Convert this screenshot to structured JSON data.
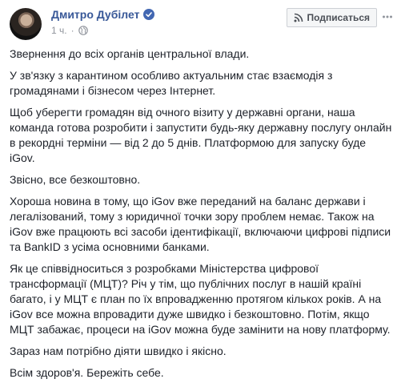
{
  "header": {
    "author_name": "Дмитро Дубілет",
    "timestamp": "1 ч.",
    "subscribe_label": "Подписаться",
    "verified_icon": "verified-badge-icon",
    "privacy_icon": "globe-icon",
    "subscribe_icon": "rss-icon",
    "more_icon": "more-options-icon"
  },
  "post": {
    "paragraphs": [
      "Звернення до всіх органів центральної влади.",
      "У зв'язку з карантином особливо актуальним стає взаємодія з громадянами і бізнесом через Інтернет.",
      "Щоб уберегти громадян від очного візиту у державні органи, наша команда готова розробити і запустити будь-яку державну послугу онлайн в рекордні терміни — від 2 до 5 днів. Платформою для запуску буде iGov.",
      "Звісно, все безкоштовно.",
      "Хороша новина в тому, що iGov вже переданий на баланс держави і легалізований, тому з юридичної точки зору проблем немає. Також на iGov вже працюють всі засоби ідентифікації, включаючи цифрові підписи та BankID з усіма основними банками.",
      "Як це співвідноситься з розробками Міністерства цифрової трансформації (МЦТ)? Річ у тім, що публічних послуг в нашій країні багато, і у МЦТ є план по їх впровадженню протягом кількох років. А на iGov все можна впровадити дуже швидко і безкоштовно. Потім, якщо МЦТ забажає, процеси на iGov можна буде замінити на нову платформу.",
      "Зараз нам потрібно діяти швидко і якісно.",
      "Всім здоров'я. Бережіть себе."
    ]
  },
  "colors": {
    "link": "#385898",
    "meta": "#90949c",
    "text": "#1d2129",
    "badge": "#4267b2"
  }
}
